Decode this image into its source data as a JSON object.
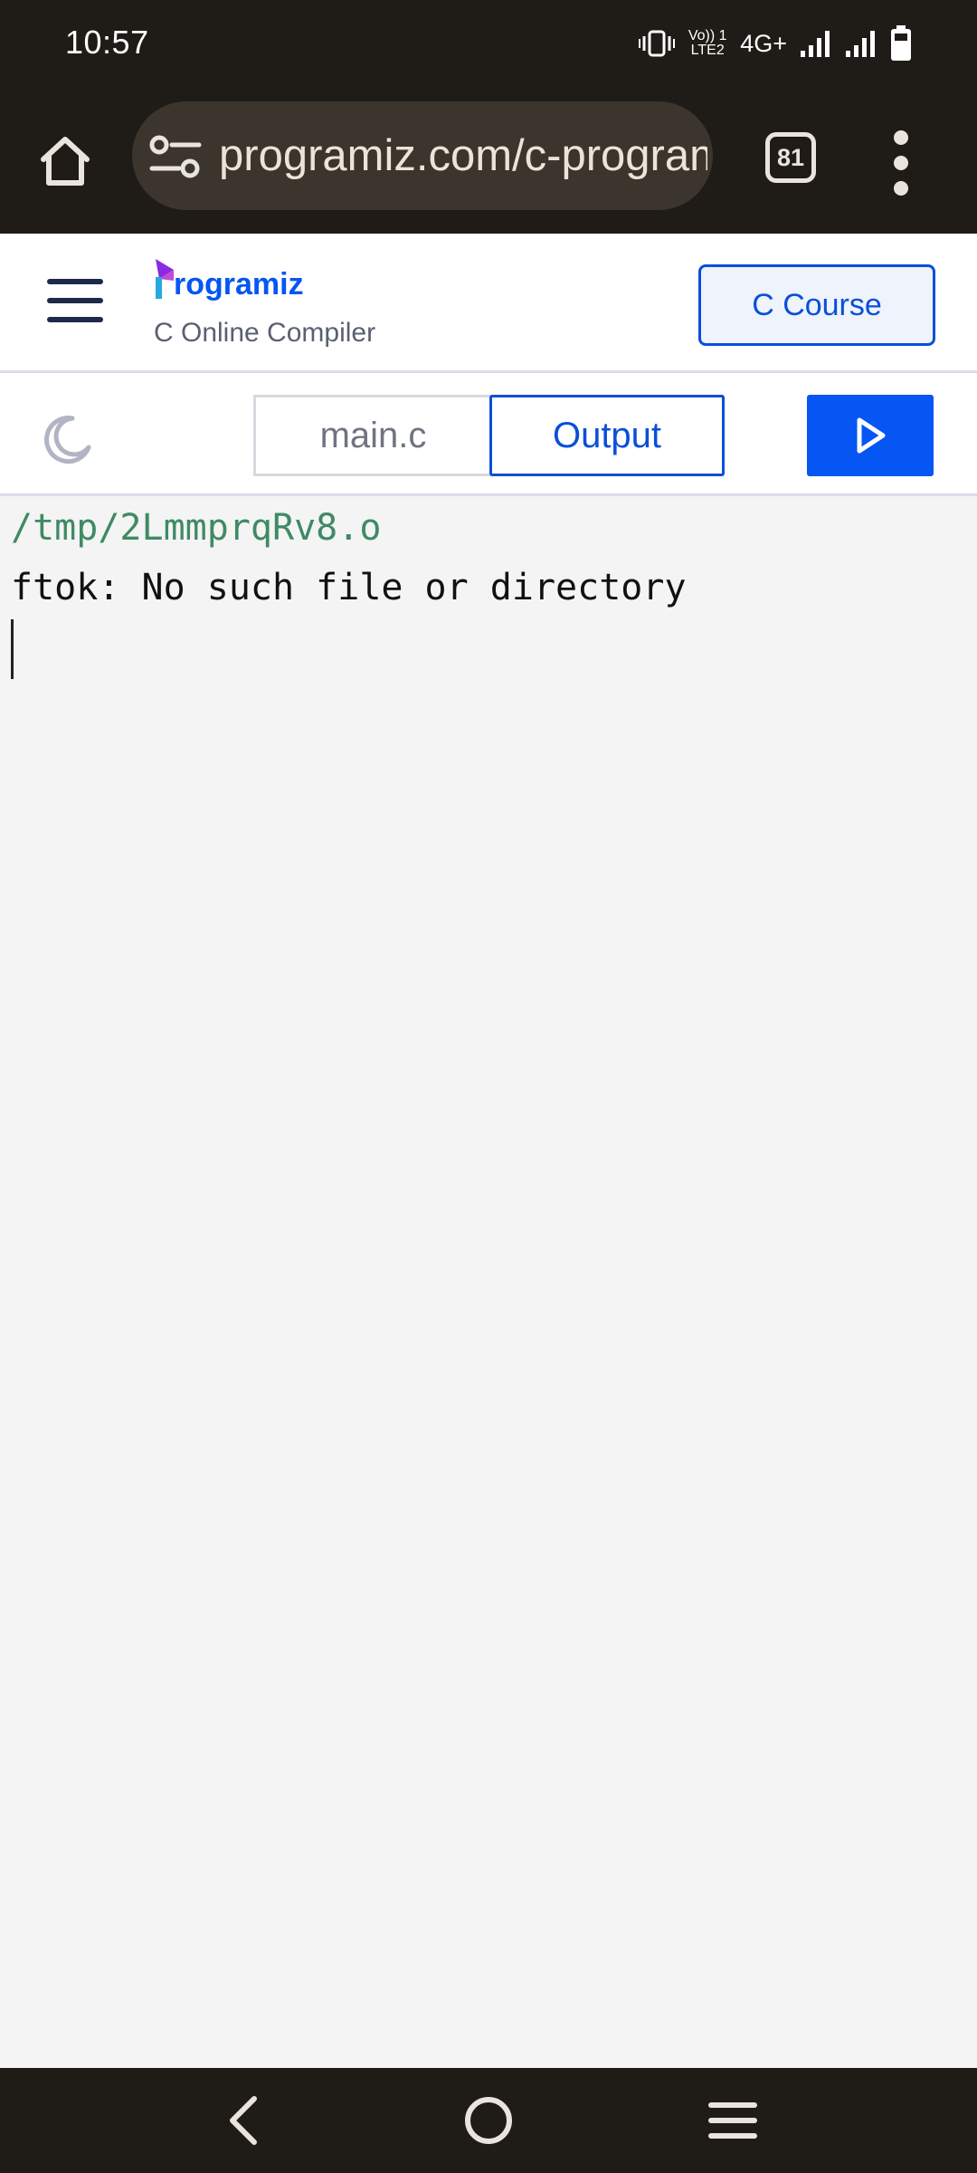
{
  "status_bar": {
    "time": "10:57",
    "volte_label": "Vo)) 1 LTE2",
    "network_label": "4G+",
    "icons": [
      "vibrate-icon",
      "signal-icon",
      "signal-icon",
      "battery-icon"
    ]
  },
  "browser": {
    "url": "programiz.com/c-programming/online-compiler/",
    "tab_count": "81",
    "icons": [
      "home-icon",
      "site-settings-icon",
      "more-vert-icon"
    ]
  },
  "site": {
    "logo_text": "rogramiz",
    "subtitle": "C Online Compiler",
    "course_button": "C Course",
    "accent_color": "#0556f3"
  },
  "toolbar": {
    "file_tab": "main.c",
    "output_tab": "Output",
    "icons": [
      "moon-icon",
      "play-icon"
    ]
  },
  "output": {
    "path_line": "/tmp/2LmmprqRv8.o",
    "message_line": "ftok: No such file or directory",
    "path_color": "#3f8a64"
  },
  "nav_bar": {
    "icons": [
      "back-icon",
      "home-circle-icon",
      "recents-icon"
    ]
  }
}
